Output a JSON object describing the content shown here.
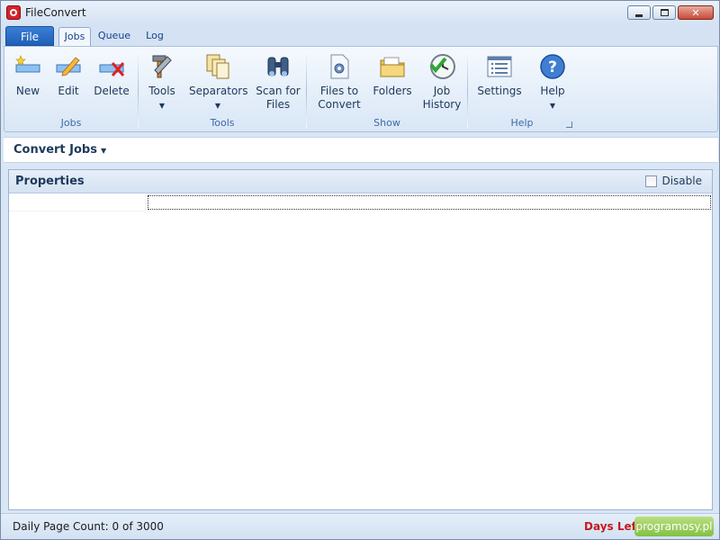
{
  "window": {
    "title": "FileConvert"
  },
  "tabs": {
    "file": "File",
    "items": [
      "Jobs",
      "Queue",
      "Log"
    ],
    "active": "Jobs"
  },
  "ribbon": {
    "groups": {
      "jobs": "Jobs",
      "tools": "Tools",
      "show": "Show",
      "help": "Help"
    },
    "buttons": {
      "new": "New",
      "edit": "Edit",
      "delete": "Delete",
      "tools": "Tools",
      "separators": "Separators",
      "scan_line1": "Scan for",
      "scan_line2": "Files",
      "files_line1": "Files to",
      "files_line2": "Convert",
      "folders": "Folders",
      "history_line1": "Job",
      "history_line2": "History",
      "settings": "Settings",
      "help": "Help"
    },
    "icons": {
      "new": "new-job-icon",
      "edit": "edit-job-icon",
      "delete": "delete-job-icon",
      "tools": "tools-icon",
      "separators": "separators-icon",
      "scan": "binoculars-icon",
      "files": "files-to-convert-icon",
      "folders": "folders-icon",
      "history": "job-history-icon",
      "settings": "settings-icon",
      "help": "help-icon"
    }
  },
  "command_bar": {
    "title": "Convert Jobs"
  },
  "properties": {
    "title": "Properties",
    "disable_label": "Disable",
    "disable_checked": false
  },
  "status": {
    "page_count": "Daily Page Count: 0 of 3000",
    "days_left": "Days Left:",
    "watermark": "programosy.pl"
  },
  "colors": {
    "accent": "#1f5fb8",
    "days_left": "#c41b1b"
  }
}
